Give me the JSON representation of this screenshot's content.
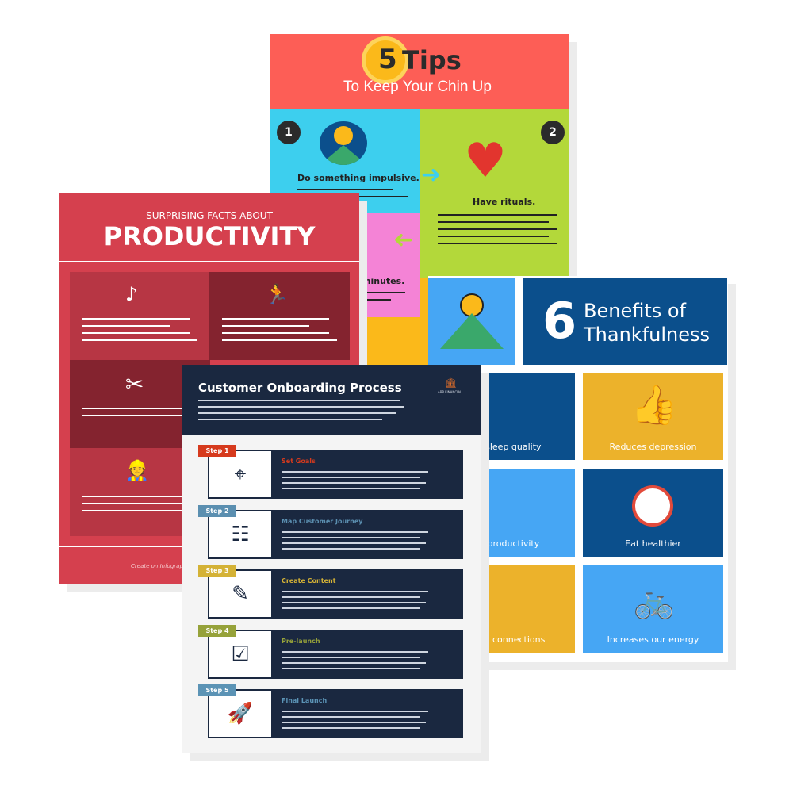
{
  "tips": {
    "number": "5",
    "title": "Tips",
    "subtitle": "To Keep Your Chin Up",
    "items": [
      {
        "num": "1",
        "label": "Do something impulsive."
      },
      {
        "num": "2",
        "label": "Have rituals."
      },
      {
        "label": "minutes."
      }
    ],
    "colors": {
      "header": "#fd5e56",
      "cyan": "#3dcfee",
      "green": "#b3d83a",
      "pink": "#f483d6",
      "orange": "#fbb91a"
    }
  },
  "thank": {
    "number": "6",
    "title_line1": "Benefits of",
    "title_line2": "Thankfulness",
    "tiles": [
      {
        "label": "ses sleep quality",
        "color": "#0b4f8c"
      },
      {
        "label": "Reduces depression",
        "color": "#ecb22b"
      },
      {
        "label": "ses productivity",
        "color": "#46a6f4"
      },
      {
        "label": "Eat healthier",
        "color": "#0b4f8c"
      },
      {
        "label": "eeper connections",
        "color": "#ecb22b"
      },
      {
        "label": "Increases our energy",
        "color": "#46a6f4"
      }
    ]
  },
  "prod": {
    "kicker": "SURPRISING FACTS ABOUT",
    "title": "PRODUCTIVITY",
    "footer": "Create on Infographic"
  },
  "onb": {
    "title": "Customer Onboarding Process",
    "logo": "ABP FINANCIAL",
    "steps": [
      {
        "tag": "Step 1",
        "title": "Set Goals",
        "color": "#d63a1d",
        "icon": "crosshair-icon"
      },
      {
        "tag": "Step 2",
        "title": "Map Customer Journey",
        "color": "#5b8fb0",
        "icon": "flowchart-icon"
      },
      {
        "tag": "Step 3",
        "title": "Create Content",
        "color": "#d4b236",
        "icon": "pencil-ruler-icon"
      },
      {
        "tag": "Step 4",
        "title": "Pre-launch",
        "color": "#96a23a",
        "icon": "checklist-icon"
      },
      {
        "tag": "Step 5",
        "title": "Final Launch",
        "color": "#5b93b5",
        "icon": "rocket-icon"
      }
    ]
  }
}
